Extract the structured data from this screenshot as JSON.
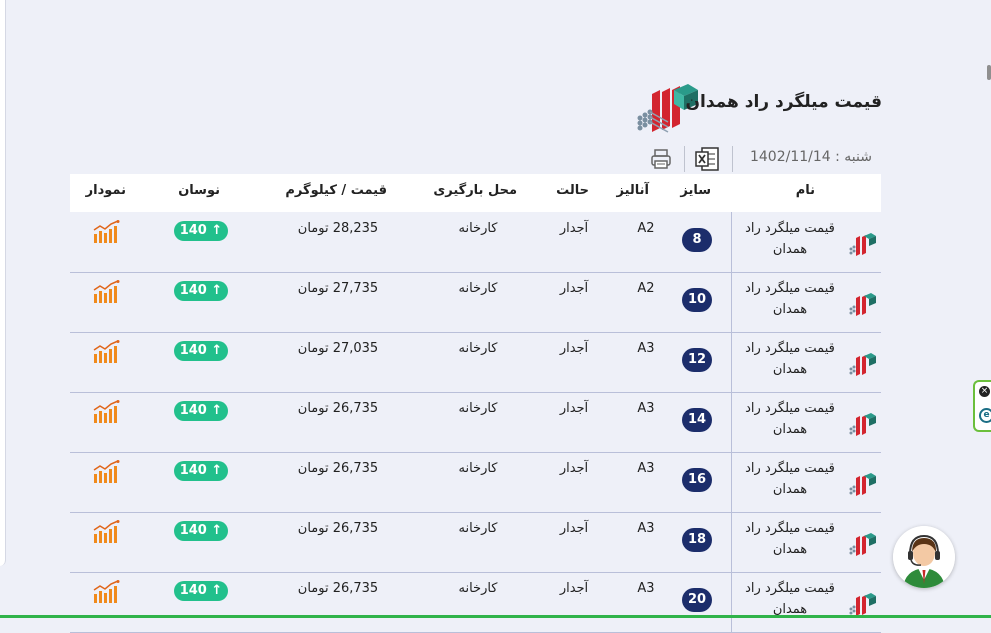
{
  "page": {
    "title": "قیمت میلگرد راد همدان",
    "date_text": "شنبه : 1402/11/14",
    "excel_icon": "excel-export-icon",
    "print_icon": "printer-icon"
  },
  "table": {
    "headers": {
      "name": "نام",
      "size": "سایز",
      "analysis": "آنالیز",
      "state": "حالت",
      "place": "محل بارگیری",
      "price": "قیمت / کیلوگرم",
      "change": "نوسان",
      "chart": "نمودار"
    },
    "rows": [
      {
        "name": "قیمت میلگرد راد همدان",
        "size": "8",
        "analysis": "A2",
        "state": "آجدار",
        "place": "کارخانه",
        "price": "28,235 تومان",
        "change": "140 ↑"
      },
      {
        "name": "قیمت میلگرد راد همدان",
        "size": "10",
        "analysis": "A2",
        "state": "آجدار",
        "place": "کارخانه",
        "price": "27,735 تومان",
        "change": "140 ↑"
      },
      {
        "name": "قیمت میلگرد راد همدان",
        "size": "12",
        "analysis": "A3",
        "state": "آجدار",
        "place": "کارخانه",
        "price": "27,035 تومان",
        "change": "140 ↑"
      },
      {
        "name": "قیمت میلگرد راد همدان",
        "size": "14",
        "analysis": "A3",
        "state": "آجدار",
        "place": "کارخانه",
        "price": "26,735 تومان",
        "change": "140 ↑"
      },
      {
        "name": "قیمت میلگرد راد همدان",
        "size": "16",
        "analysis": "A3",
        "state": "آجدار",
        "place": "کارخانه",
        "price": "26,735 تومان",
        "change": "140 ↑"
      },
      {
        "name": "قیمت میلگرد راد همدان",
        "size": "18",
        "analysis": "A3",
        "state": "آجدار",
        "place": "کارخانه",
        "price": "26,735 تومان",
        "change": "140 ↑"
      },
      {
        "name": "قیمت میلگرد راد همدان",
        "size": "20",
        "analysis": "A3",
        "state": "آجدار",
        "place": "کارخانه",
        "price": "26,735 تومان",
        "change": "140 ↑"
      }
    ]
  },
  "colors": {
    "size_badge": "#1c2d6b",
    "change_badge": "#22c08c",
    "chart_icon": "#f08a1c",
    "background": "#eef0f8"
  },
  "widgets": {
    "support_icon": "support-agent-icon",
    "side_close": "×",
    "side_label": "e"
  }
}
